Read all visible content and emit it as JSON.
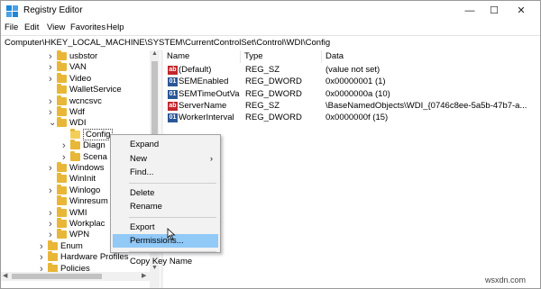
{
  "window": {
    "title": "Registry Editor",
    "minimize": "—",
    "maximize": "☐",
    "close": "✕"
  },
  "menu": [
    "File",
    "Edit",
    "View",
    "Favorites",
    "Help"
  ],
  "address": "Computer\\HKEY_LOCAL_MACHINE\\SYSTEM\\CurrentControlSet\\Control\\WDI\\Config",
  "tree": {
    "nodes": [
      {
        "label": "usbstor",
        "expander": "right"
      },
      {
        "label": "VAN",
        "expander": "right"
      },
      {
        "label": "Video",
        "expander": "right"
      },
      {
        "label": "WalletService",
        "expander": "none"
      },
      {
        "label": "wcncsvc",
        "expander": "right"
      },
      {
        "label": "Wdf",
        "expander": "right"
      },
      {
        "label": "WDI",
        "expander": "down"
      },
      {
        "label": "Config",
        "expander": "none",
        "selected": true
      },
      {
        "label": "Diagn",
        "expander": "right"
      },
      {
        "label": "Scena",
        "expander": "right"
      },
      {
        "label": "Windows",
        "expander": "right"
      },
      {
        "label": "WinInit",
        "expander": "none"
      },
      {
        "label": "Winlogo",
        "expander": "right"
      },
      {
        "label": "Winresum",
        "expander": "none"
      },
      {
        "label": "WMI",
        "expander": "right"
      },
      {
        "label": "Workplac",
        "expander": "right"
      },
      {
        "label": "WPN",
        "expander": "right"
      },
      {
        "label": "Enum",
        "expander": "right"
      },
      {
        "label": "Hardware Profiles",
        "expander": "right"
      },
      {
        "label": "Policies",
        "expander": "right"
      }
    ]
  },
  "values": {
    "headers": [
      "Name",
      "Type",
      "Data"
    ],
    "rows": [
      {
        "icon": "string-value-icon",
        "name": "(Default)",
        "type": "REG_SZ",
        "data": "(value not set)"
      },
      {
        "icon": "dword-value-icon",
        "name": "SEMEnabled",
        "type": "REG_DWORD",
        "data": "0x00000001 (1)"
      },
      {
        "icon": "dword-value-icon",
        "name": "SEMTimeOutValue",
        "type": "REG_DWORD",
        "data": "0x0000000a (10)"
      },
      {
        "icon": "string-value-icon",
        "name": "ServerName",
        "type": "REG_SZ",
        "data": "\\BaseNamedObjects\\WDI_{0746c8ee-5a5b-47b7-a..."
      },
      {
        "icon": "dword-value-icon",
        "name": "WorkerInterval",
        "type": "REG_DWORD",
        "data": "0x0000000f (15)"
      }
    ]
  },
  "context_menu": {
    "items": [
      {
        "label": "Expand",
        "type": "item"
      },
      {
        "label": "New",
        "type": "submenu"
      },
      {
        "label": "Find...",
        "type": "item"
      },
      {
        "type": "separator"
      },
      {
        "label": "Delete",
        "type": "item"
      },
      {
        "label": "Rename",
        "type": "item"
      },
      {
        "type": "separator"
      },
      {
        "label": "Export",
        "type": "item"
      },
      {
        "label": "Permissions...",
        "type": "item",
        "highlighted": true
      },
      {
        "type": "separator"
      },
      {
        "label": "Copy Key Name",
        "type": "item"
      }
    ]
  },
  "watermark": "wsxdn.com",
  "colors": {
    "highlight": "#91c9f7",
    "folder": "#e8b737",
    "string_icon": "#c1272d",
    "dword_icon": "#2b5797"
  }
}
